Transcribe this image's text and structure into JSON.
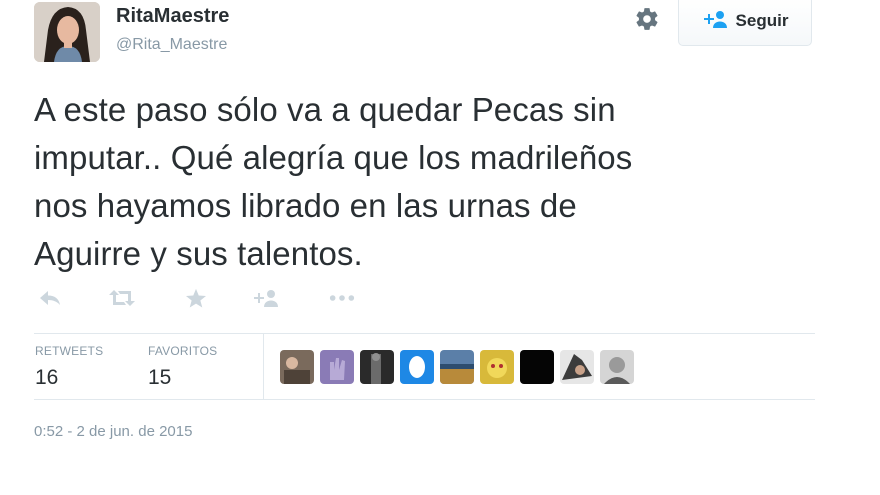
{
  "user": {
    "display_name": "RitaMaestre",
    "screen_name": "@Rita_Maestre",
    "avatar_icon": "profile-photo"
  },
  "header": {
    "settings_icon": "gear-icon",
    "follow_label": "Seguir",
    "follow_icon": "add-user-icon"
  },
  "tweet": {
    "line1": "A este paso sólo va a quedar Pecas sin",
    "line2": "imputar.. Qué alegría que los madrileños",
    "line3": "nos hayamos librado en las urnas de",
    "line4": "Aguirre y sus talentos."
  },
  "actions": [
    {
      "icon": "reply-icon"
    },
    {
      "icon": "retweet-icon"
    },
    {
      "icon": "star-icon"
    },
    {
      "icon": "add-user-icon"
    },
    {
      "icon": "more-icon"
    }
  ],
  "stats": {
    "retweets_label": "RETWEETS",
    "retweets_value": "16",
    "favorites_label": "FAVORITOS",
    "favorites_value": "15"
  },
  "favoriters": [
    {
      "icon": "avatar-1",
      "color": "#7a6a5c"
    },
    {
      "icon": "avatar-2",
      "color": "#8a7bb6"
    },
    {
      "icon": "avatar-3",
      "color": "#4a4a4a"
    },
    {
      "icon": "avatar-4",
      "color": "#1e88e5"
    },
    {
      "icon": "avatar-5",
      "color": "#5b7fa8"
    },
    {
      "icon": "avatar-6",
      "color": "#d8b93a"
    },
    {
      "icon": "avatar-7",
      "color": "#050505"
    },
    {
      "icon": "avatar-8",
      "color": "#6e6e6e"
    },
    {
      "icon": "avatar-9",
      "color": "#b5b5b5"
    }
  ],
  "timestamp": "0:52 - 2 de jun. de 2015",
  "colors": {
    "text": "#292f33",
    "muted": "#8899a6",
    "icon": "#ccd6dd",
    "border": "#e1e8ed"
  }
}
